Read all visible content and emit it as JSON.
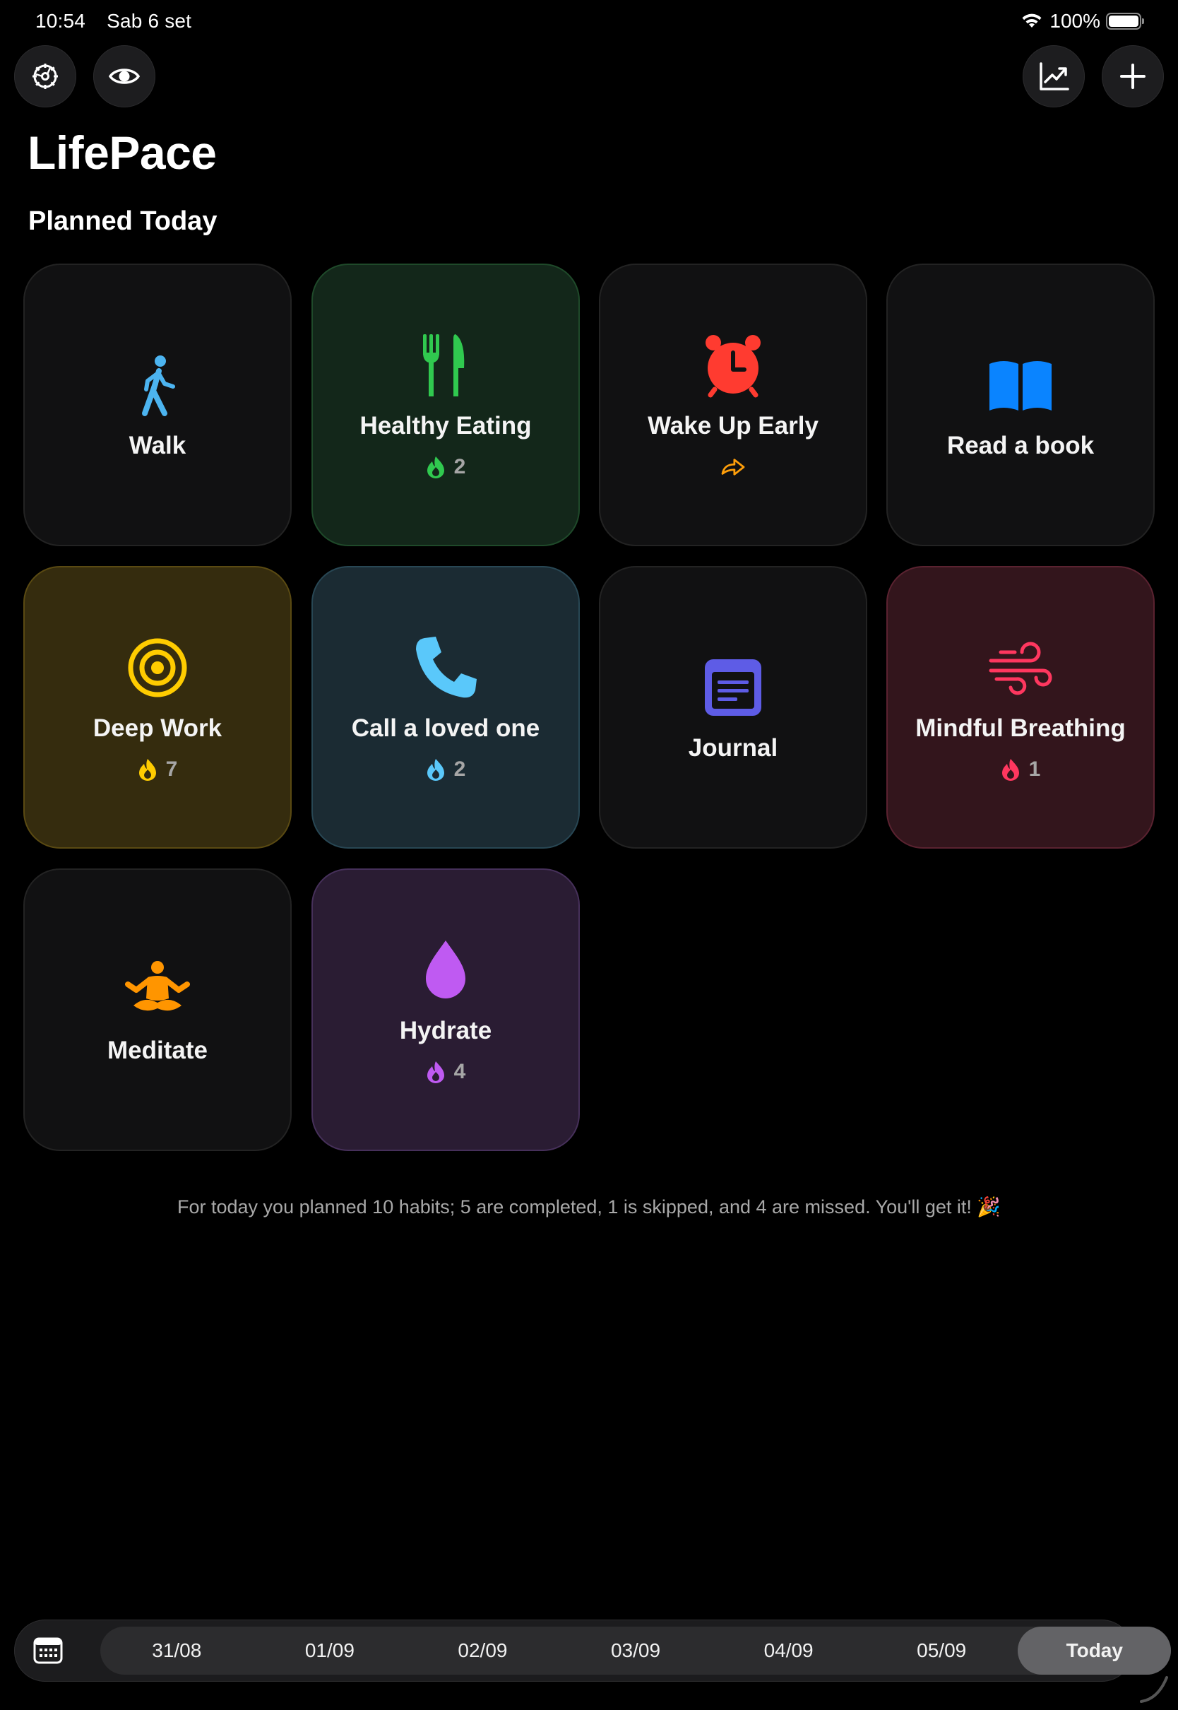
{
  "status_bar": {
    "time": "10:54",
    "date": "Sab 6 set",
    "battery": "100%"
  },
  "toolbar": {
    "settings_icon": "gear-icon",
    "visibility_icon": "eye-icon",
    "stats_icon": "chart-line-icon",
    "add_icon": "plus-icon"
  },
  "app_title": "LifePace",
  "section_title": "Planned Today",
  "habits": [
    {
      "name": "Walk",
      "icon": "figure-walk-icon",
      "color": "#4cb4f0",
      "streak": "",
      "theme": "default"
    },
    {
      "name": "Healthy Eating",
      "icon": "fork-knife-icon",
      "color": "#30c94f",
      "streak": "2",
      "theme": "green"
    },
    {
      "name": "Wake Up Early",
      "icon": "alarm-clock-icon",
      "color": "#ff3b30",
      "streak": "",
      "status_icon": "skip-arrow-icon",
      "theme": "default"
    },
    {
      "name": "Read a book",
      "icon": "book-icon",
      "color": "#0a84ff",
      "streak": "",
      "theme": "default"
    },
    {
      "name": "Deep Work",
      "icon": "target-icon",
      "color": "#ffcc00",
      "streak": "7",
      "theme": "yellow"
    },
    {
      "name": "Call a loved one",
      "icon": "phone-icon",
      "color": "#5ac8fa",
      "streak": "2",
      "theme": "teal"
    },
    {
      "name": "Journal",
      "icon": "journal-icon",
      "color": "#5e5ce6",
      "streak": "",
      "theme": "default"
    },
    {
      "name": "Mindful Breathing",
      "icon": "wind-icon",
      "color": "#ff375f",
      "streak": "1",
      "theme": "red"
    },
    {
      "name": "Meditate",
      "icon": "meditate-icon",
      "color": "#ff9500",
      "streak": "",
      "theme": "default"
    },
    {
      "name": "Hydrate",
      "icon": "drop-icon",
      "color": "#bf5af2",
      "streak": "4",
      "theme": "purple"
    }
  ],
  "summary": "For today you planned 10 habits; 5 are completed, 1 is skipped, and 4 are missed. You'll get it! 🎉",
  "date_bar": {
    "calendar_icon": "calendar-icon",
    "dates": [
      "31/08",
      "01/09",
      "02/09",
      "03/09",
      "04/09",
      "05/09",
      "Today"
    ],
    "selected": "Today"
  }
}
